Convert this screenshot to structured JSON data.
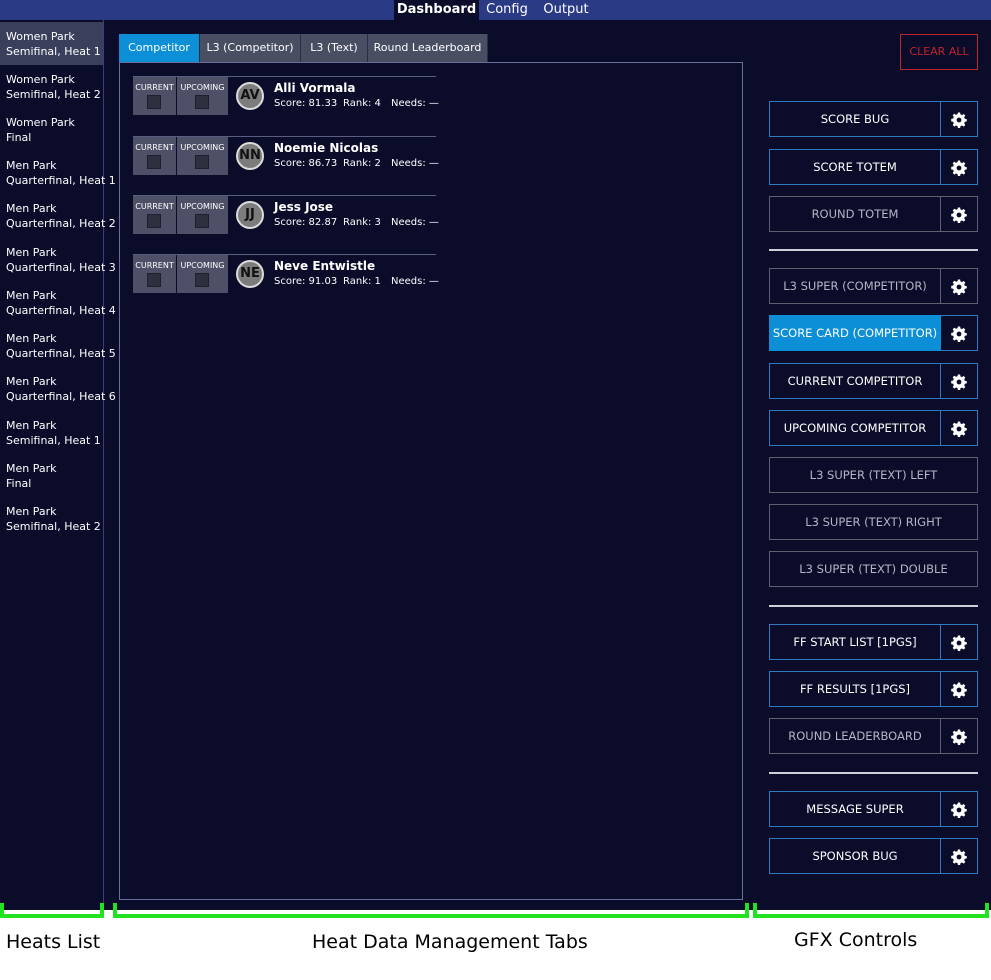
{
  "nav": [
    "Dashboard",
    "Config",
    "Output"
  ],
  "heats": [
    [
      "Women Park",
      "Semifinal, Heat 1"
    ],
    [
      "Women Park",
      "Semifinal, Heat 2"
    ],
    [
      "Women Park",
      "Final"
    ],
    [
      "Men Park",
      "Quarterfinal, Heat 1"
    ],
    [
      "Men Park",
      "Quarterfinal, Heat 2"
    ],
    [
      "Men Park",
      "Quarterfinal, Heat 3"
    ],
    [
      "Men Park",
      "Quarterfinal, Heat 4"
    ],
    [
      "Men Park",
      "Quarterfinal, Heat 5"
    ],
    [
      "Men Park",
      "Quarterfinal, Heat 6"
    ],
    [
      "Men Park",
      "Semifinal, Heat 1"
    ],
    [
      "Men Park",
      "Final"
    ],
    [
      "Men Park",
      "Semifinal, Heat 2"
    ]
  ],
  "tabs": [
    "Competitor",
    "L3 (Competitor)",
    "L3 (Text)",
    "Round Leaderboard"
  ],
  "checkbox_labels": {
    "current": "CURRENT",
    "upcoming": "UPCOMING"
  },
  "competitors": [
    {
      "initials": "AV",
      "name": "Alli Vormala",
      "score": "Score: 81.33",
      "rank": "Rank: 4",
      "needs": "Needs: —"
    },
    {
      "initials": "NN",
      "name": "Noemie Nicolas",
      "score": "Score: 86.73",
      "rank": "Rank: 2",
      "needs": "Needs: —"
    },
    {
      "initials": "JJ",
      "name": "Jess Jose",
      "score": "Score: 82.87",
      "rank": "Rank: 3",
      "needs": "Needs: —"
    },
    {
      "initials": "NE",
      "name": "Neve Entwistle",
      "score": "Score: 91.03",
      "rank": "Rank: 1",
      "needs": "Needs: —"
    }
  ],
  "clear_all": "CLEAR ALL",
  "gfx": {
    "score_bug": "SCORE BUG",
    "score_totem": "SCORE TOTEM",
    "round_totem": "ROUND TOTEM",
    "l3_super_competitor": "L3 SUPER (COMPETITOR)",
    "score_card_competitor": "SCORE CARD (COMPETITOR)",
    "current_competitor": "CURRENT COMPETITOR",
    "upcoming_competitor": "UPCOMING COMPETITOR",
    "l3_text_left": "L3 SUPER (TEXT) LEFT",
    "l3_text_right": "L3 SUPER (TEXT) RIGHT",
    "l3_text_double": "L3 SUPER (TEXT) DOUBLE",
    "ff_start_list": "FF START LIST [1PGS]",
    "ff_results": "FF RESULTS [1PGS]",
    "round_leaderboard": "ROUND LEADERBOARD",
    "message_super": "MESSAGE SUPER",
    "sponsor_bug": "SPONSOR BUG"
  },
  "annotations": {
    "heats_list": "Heats List",
    "heat_data_tabs": "Heat Data Management Tabs",
    "gfx_controls": "GFX Controls"
  },
  "colors": {
    "background": "#0b0c2a",
    "nav_bar": "#2b3a85",
    "accent_blue": "#0c8fd6",
    "clear_red": "#c0242e",
    "annotation_green": "#22e322"
  }
}
